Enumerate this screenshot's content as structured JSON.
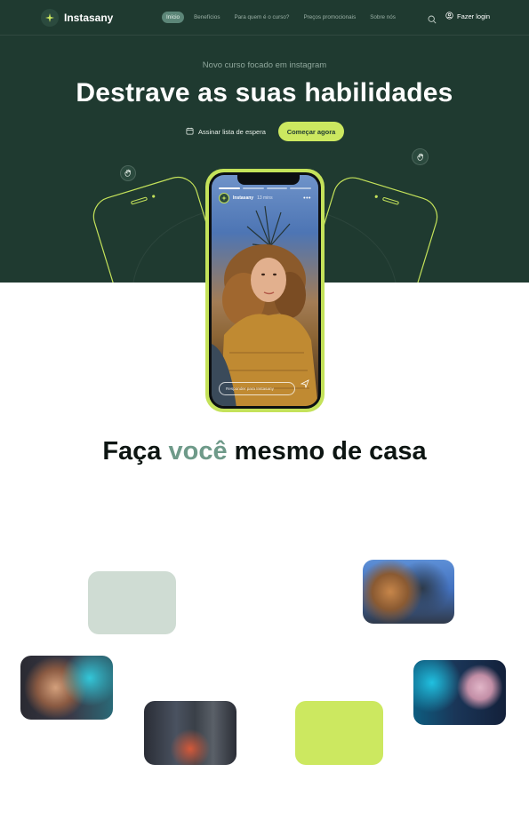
{
  "nav": {
    "brand": "Instasany",
    "links": [
      "Início",
      "Benefícios",
      "Para quem é o curso?",
      "Preços promocionais",
      "Sobre nós"
    ],
    "active_index": 0,
    "login_label": "Fazer login",
    "icons": {
      "search": "search-icon",
      "login": "user-icon",
      "logo": "sparkle-icon"
    }
  },
  "hero": {
    "subtitle": "Novo curso focado em instagram",
    "title": "Destrave as suas habilidades",
    "waitlist_label": "Assinar lista de espera",
    "cta_label": "Começar agora"
  },
  "phone": {
    "story_user": "Instasany",
    "story_time": "13 mins",
    "reply_placeholder": "Responder para Instasany"
  },
  "section": {
    "title_before": "Faça",
    "title_accent": "você",
    "title_after": "mesmo de casa"
  },
  "colors": {
    "hero_bg": "#1f3a30",
    "accent_lime": "#cce860",
    "accent_sage": "#6e9a89",
    "tile_sage": "#cfdcd3"
  }
}
